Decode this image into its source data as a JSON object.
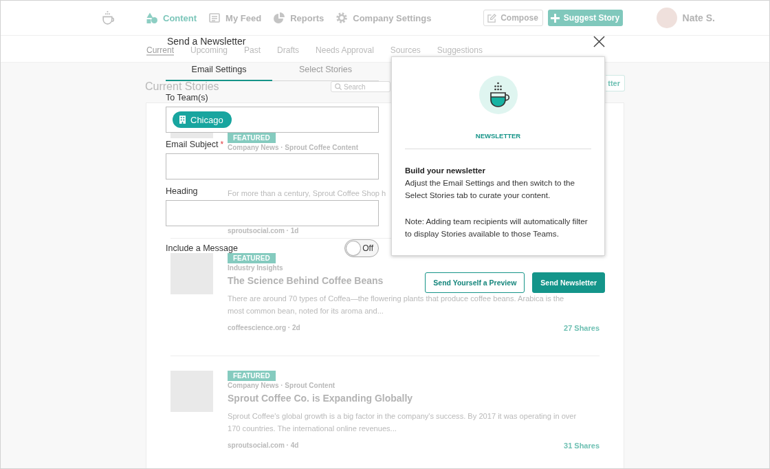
{
  "app_header": {
    "nav": [
      {
        "label": "Content",
        "selected": true
      },
      {
        "label": "My Feed",
        "selected": false
      },
      {
        "label": "Reports",
        "selected": false
      },
      {
        "label": "Company Settings",
        "selected": false
      }
    ],
    "compose_button": "Compose",
    "suggest_button": "Suggest Story",
    "user_name": "Nate S."
  },
  "subtabs": [
    {
      "label": "Current",
      "selected": true
    },
    {
      "label": "Upcoming",
      "selected": false
    },
    {
      "label": "Past",
      "selected": false
    },
    {
      "label": "Drafts",
      "selected": false
    },
    {
      "label": "Needs Approval",
      "selected": false
    },
    {
      "label": "Sources",
      "selected": false
    },
    {
      "label": "Suggestions",
      "selected": false
    }
  ],
  "toolbar": {
    "title": "Current Stories",
    "search": {
      "placeholder": "Search"
    },
    "button": "tter"
  },
  "stories": [
    {
      "badge": "FEATURED",
      "category": "Company News · Sprout Coffee Content",
      "description": "For more than a century, Sprout Coffee Shop h",
      "source": "sproutsocial.com · 1d"
    },
    {
      "badge": "FEATURED",
      "category": "Industry Insights",
      "title": "The Science Behind Coffee Beans",
      "description": "There are around 70 types of Coffea—the flowering plants that produce coffee beans. Arabica is the most common bean, noted for its aroma and...",
      "source": "coffeescience.org · 2d",
      "shares": "27 Shares"
    },
    {
      "badge": "FEATURED",
      "category": "Company News · Sprout Content",
      "title": "Sprout Coffee Co. is Expanding Globally",
      "description": "Sprout Coffee's global growth is a big factor in the company's success. By 2017 it was operating in over 170 countries. The international online revenues...",
      "source": "sproutsocial.com · 4d",
      "shares": "31 Shares"
    }
  ],
  "modal": {
    "title": "Send a Newsletter",
    "tabs": [
      {
        "label": "Email Settings",
        "selected": true
      },
      {
        "label": "Select Stories",
        "selected": false
      }
    ],
    "fields": [
      {
        "kind": "chips",
        "label": "To Team(s)",
        "chips": [
          "Chicago"
        ]
      },
      {
        "kind": "text",
        "label": "Email Subject",
        "required_mark": "*"
      },
      {
        "kind": "text",
        "label": "Heading"
      }
    ],
    "toggle": {
      "label": "Include a Message",
      "on": false,
      "state_text": "Off"
    },
    "info": {
      "title": "NEWSLETTER",
      "heading": "Build your newsletter",
      "paragraphs": [
        "Adjust the Email Settings and then switch to the Select Stories tab to curate your content.",
        "Note: Adding team recipients will automatically filter to display Stories available to those Teams."
      ]
    },
    "buttons": [
      {
        "label": "Send Yourself a Preview",
        "kind": "secondary"
      },
      {
        "label": "Send Newsletter",
        "kind": "primary"
      }
    ]
  }
}
